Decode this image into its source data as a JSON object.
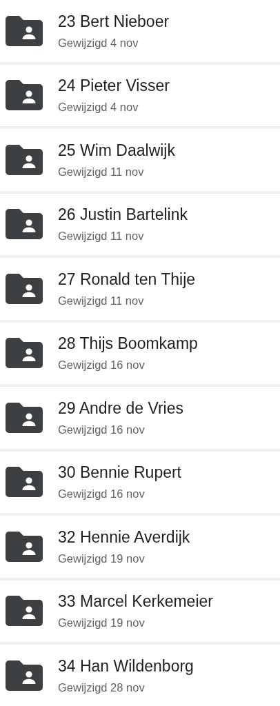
{
  "folders": [
    {
      "name": "23 Bert Nieboer",
      "modified": "Gewijzigd 4 nov"
    },
    {
      "name": "24 Pieter Visser",
      "modified": "Gewijzigd 4 nov"
    },
    {
      "name": "25 Wim Daalwijk",
      "modified": "Gewijzigd 11 nov"
    },
    {
      "name": "26 Justin Bartelink",
      "modified": "Gewijzigd 11 nov"
    },
    {
      "name": "27 Ronald ten Thije",
      "modified": "Gewijzigd 11 nov"
    },
    {
      "name": "28 Thijs Boomkamp",
      "modified": "Gewijzigd 16 nov"
    },
    {
      "name": "29 Andre de Vries",
      "modified": "Gewijzigd 16 nov"
    },
    {
      "name": "30 Bennie Rupert",
      "modified": "Gewijzigd 16 nov"
    },
    {
      "name": "32 Hennie Averdijk",
      "modified": "Gewijzigd 19 nov"
    },
    {
      "name": "33 Marcel Kerkemeier",
      "modified": "Gewijzigd 19 nov"
    },
    {
      "name": "34 Han Wildenborg",
      "modified": "Gewijzigd 28 nov"
    }
  ]
}
